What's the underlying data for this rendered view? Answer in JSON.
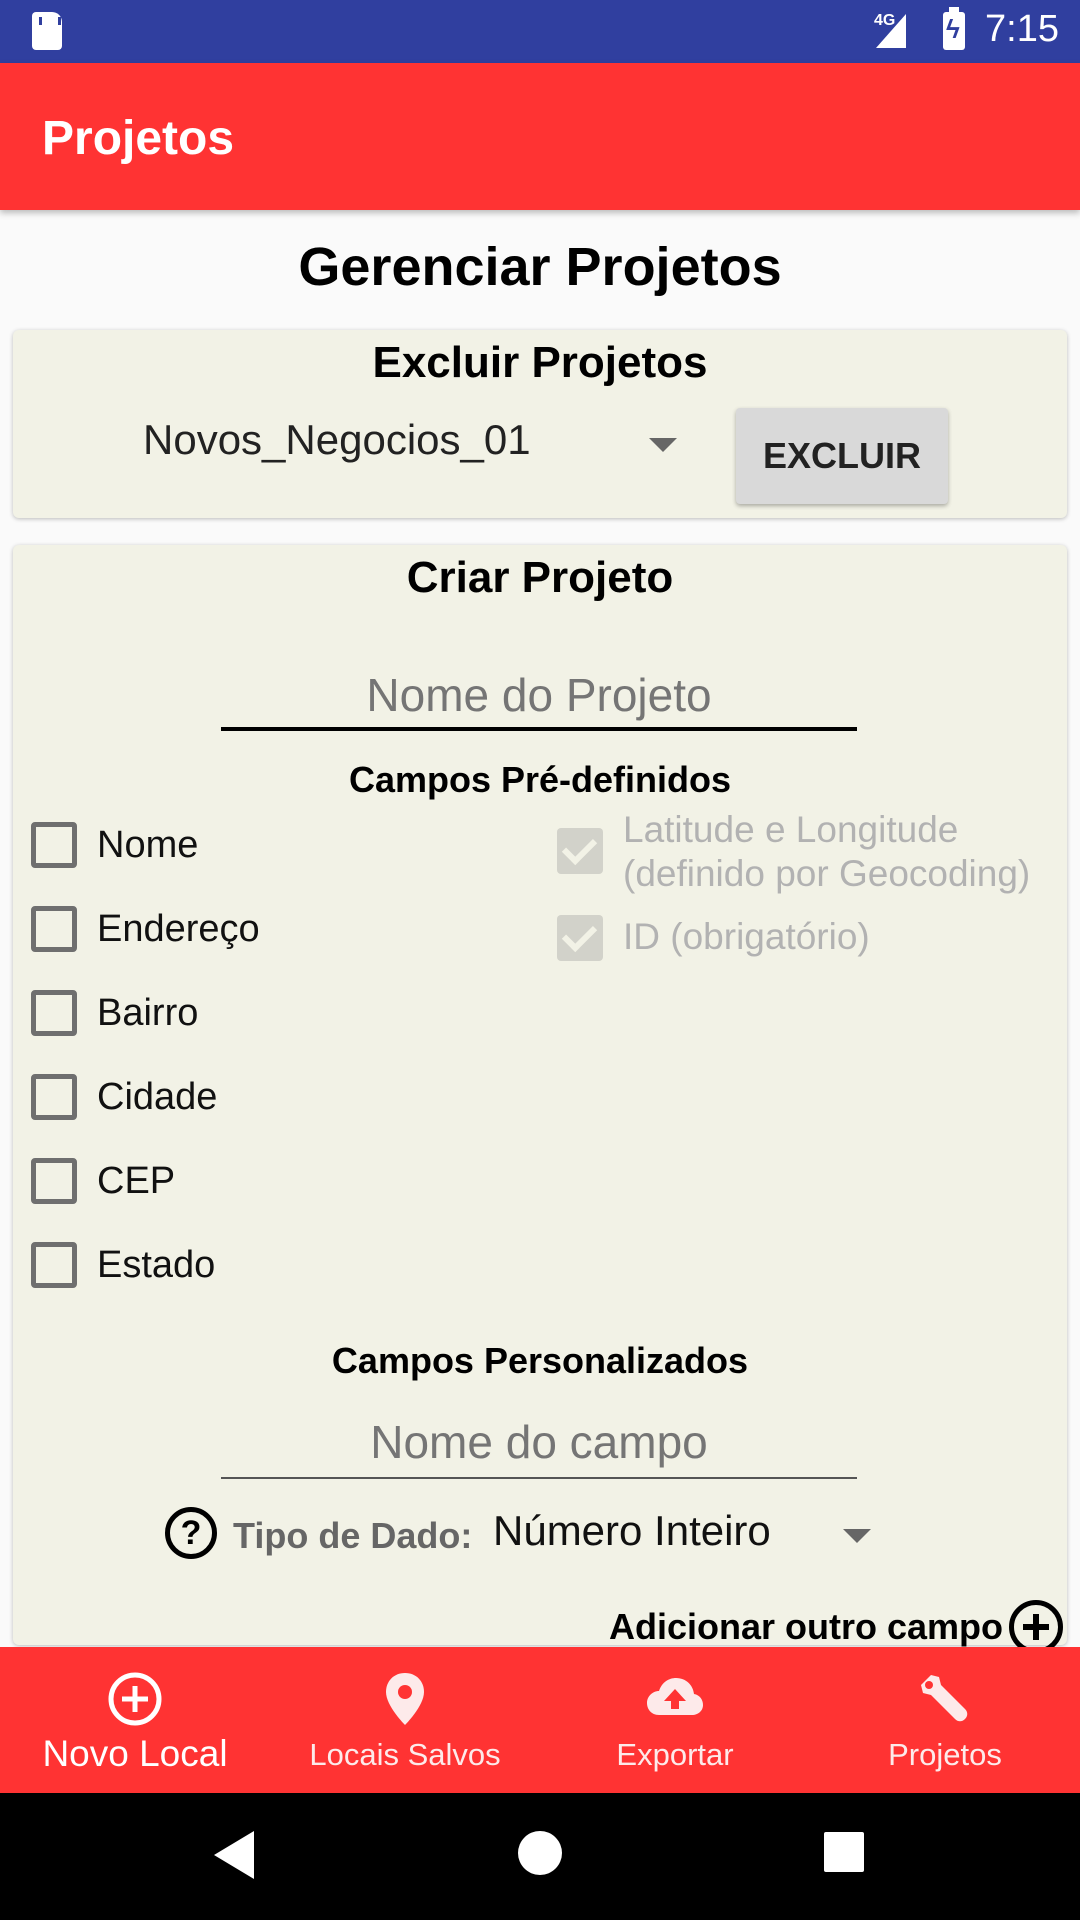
{
  "status_bar": {
    "network": "4G",
    "time": "7:15"
  },
  "app_bar": {
    "title": "Projetos"
  },
  "page_heading": "Gerenciar Projetos",
  "excluir": {
    "title": "Excluir Projetos",
    "selected_project": "Novos_Negocios_01",
    "button_label": "EXCLUIR"
  },
  "criar": {
    "title": "Criar Projeto",
    "name_placeholder": "Nome do Projeto",
    "predefined_label": "Campos Pré-definidos",
    "checkboxes": [
      {
        "label": "Nome",
        "checked": false
      },
      {
        "label": "Endereço",
        "checked": false
      },
      {
        "label": "Bairro",
        "checked": false
      },
      {
        "label": "Cidade",
        "checked": false
      },
      {
        "label": "CEP",
        "checked": false
      },
      {
        "label": "Estado",
        "checked": false
      }
    ],
    "fixed_fields": [
      {
        "label_line1": "Latitude e Longitude",
        "label_line2": "(definido por Geocoding)",
        "checked": true,
        "enabled": false
      },
      {
        "label_line1": "ID (obrigatório)",
        "checked": true,
        "enabled": false
      }
    ],
    "custom_label": "Campos Personalizados",
    "field_placeholder": "Nome do campo",
    "tipo_label": "Tipo de Dado:",
    "tipo_value": "Número Inteiro",
    "help_glyph": "?",
    "add_label": "Adicionar outro campo"
  },
  "bottom_nav": {
    "items": [
      {
        "label": "Novo Local",
        "icon": "add-circle-icon",
        "active": true
      },
      {
        "label": "Locais Salvos",
        "icon": "location-pin-icon",
        "active": false
      },
      {
        "label": "Exportar",
        "icon": "cloud-upload-icon",
        "active": false
      },
      {
        "label": "Projetos",
        "icon": "wrench-icon",
        "active": false
      }
    ]
  },
  "colors": {
    "primary": "#ff3333",
    "status_bar": "#303F9F",
    "card": "#f2f2e6"
  }
}
